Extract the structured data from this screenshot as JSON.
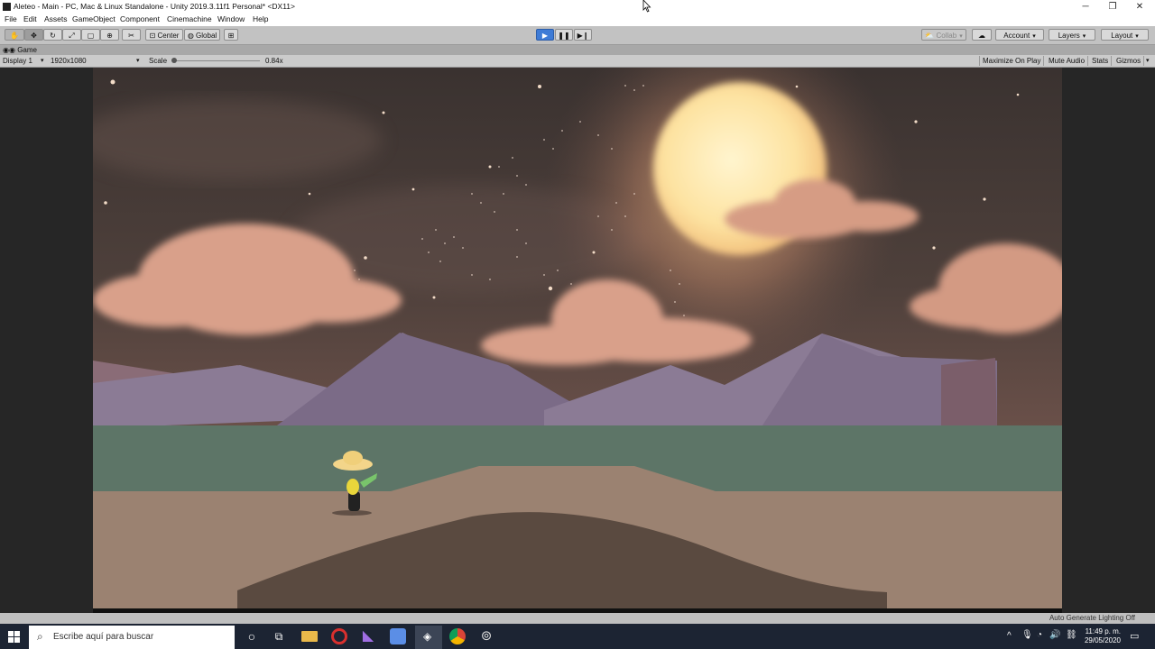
{
  "window": {
    "title": "Aleteo - Main - PC, Mac & Linux Standalone - Unity 2019.3.11f1 Personal* <DX11>",
    "controls": [
      "─",
      "❐",
      "✕"
    ]
  },
  "menu": [
    "File",
    "Edit",
    "Assets",
    "GameObject",
    "Component",
    "Cinemachine",
    "Window",
    "Help"
  ],
  "toolbar": {
    "tools": [
      "hand-tool-icon",
      "move-tool-icon",
      "rotate-tool-icon",
      "scale-tool-icon",
      "rect-tool-icon",
      "transform-tool-icon",
      "custom-tool-icon"
    ],
    "pivot_label": "Center",
    "space_label": "Global",
    "collab_label": "Collab",
    "account_label": "Account",
    "layers_label": "Layers",
    "layout_label": "Layout"
  },
  "game_tab": {
    "tab_label": "Game",
    "display_label": "Display 1",
    "resolution_label": "1920x1080",
    "scale_label": "Scale",
    "scale_value": "0.84x",
    "maximize_label": "Maximize On Play",
    "mute_label": "Mute Audio",
    "stats_label": "Stats",
    "gizmos_label": "Gizmos"
  },
  "status": {
    "lighting_text": "Auto Generate Lighting Off"
  },
  "taskbar": {
    "search_placeholder": "Escribe aquí para buscar",
    "time": "11:49 p. m.",
    "date": "29/05/2020"
  },
  "colors": {
    "play_active": "#3e7bd6",
    "sky_top": "#3d3532",
    "sky_bottom": "#5e4a44",
    "moon": "#fde6a9",
    "cloud": "#d99e86",
    "mountain": "#8a7a93",
    "river": "#5c7566",
    "ground": "#9b8271",
    "ground_dark": "#5a4a40",
    "taskbar": "#1c2433"
  }
}
